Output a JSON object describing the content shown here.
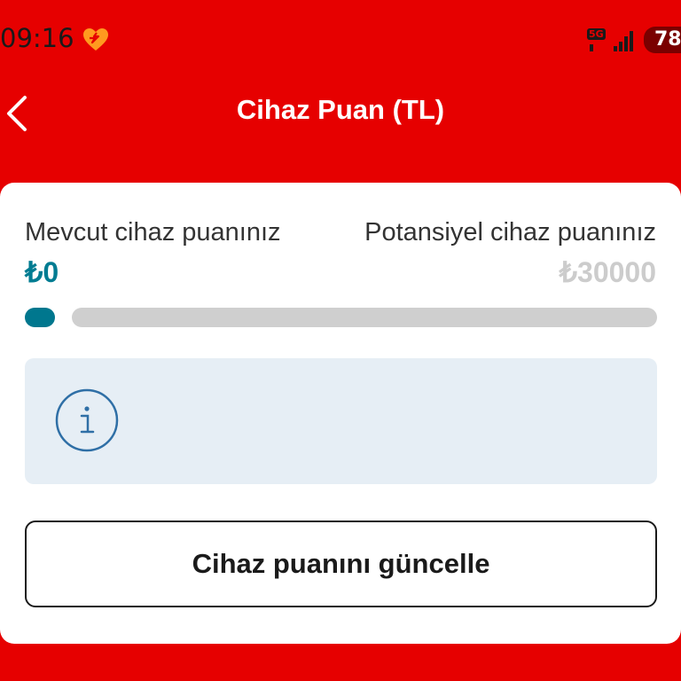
{
  "status_bar": {
    "time": "09:16",
    "network": "5G",
    "battery": "78",
    "icons": [
      "heart-icon",
      "signal-icon",
      "battery-icon"
    ]
  },
  "header": {
    "title": "Cihaz Puan (TL)",
    "back_icon": "chevron-left-icon"
  },
  "points": {
    "current_label": "Mevcut cihaz puanınız",
    "current_value": "₺0",
    "potential_label": "Potansiyel cihaz puanınız",
    "potential_value": "₺30000",
    "progress_fraction": 0
  },
  "info": {
    "icon": "info-icon",
    "text": ""
  },
  "actions": {
    "update_label": "Cihaz puanını güncelle"
  },
  "colors": {
    "brand_red": "#e60000",
    "accent_teal": "#007c92",
    "muted_value": "#cccccc",
    "track": "#cfcfcf",
    "info_bg": "#e6eef5"
  }
}
